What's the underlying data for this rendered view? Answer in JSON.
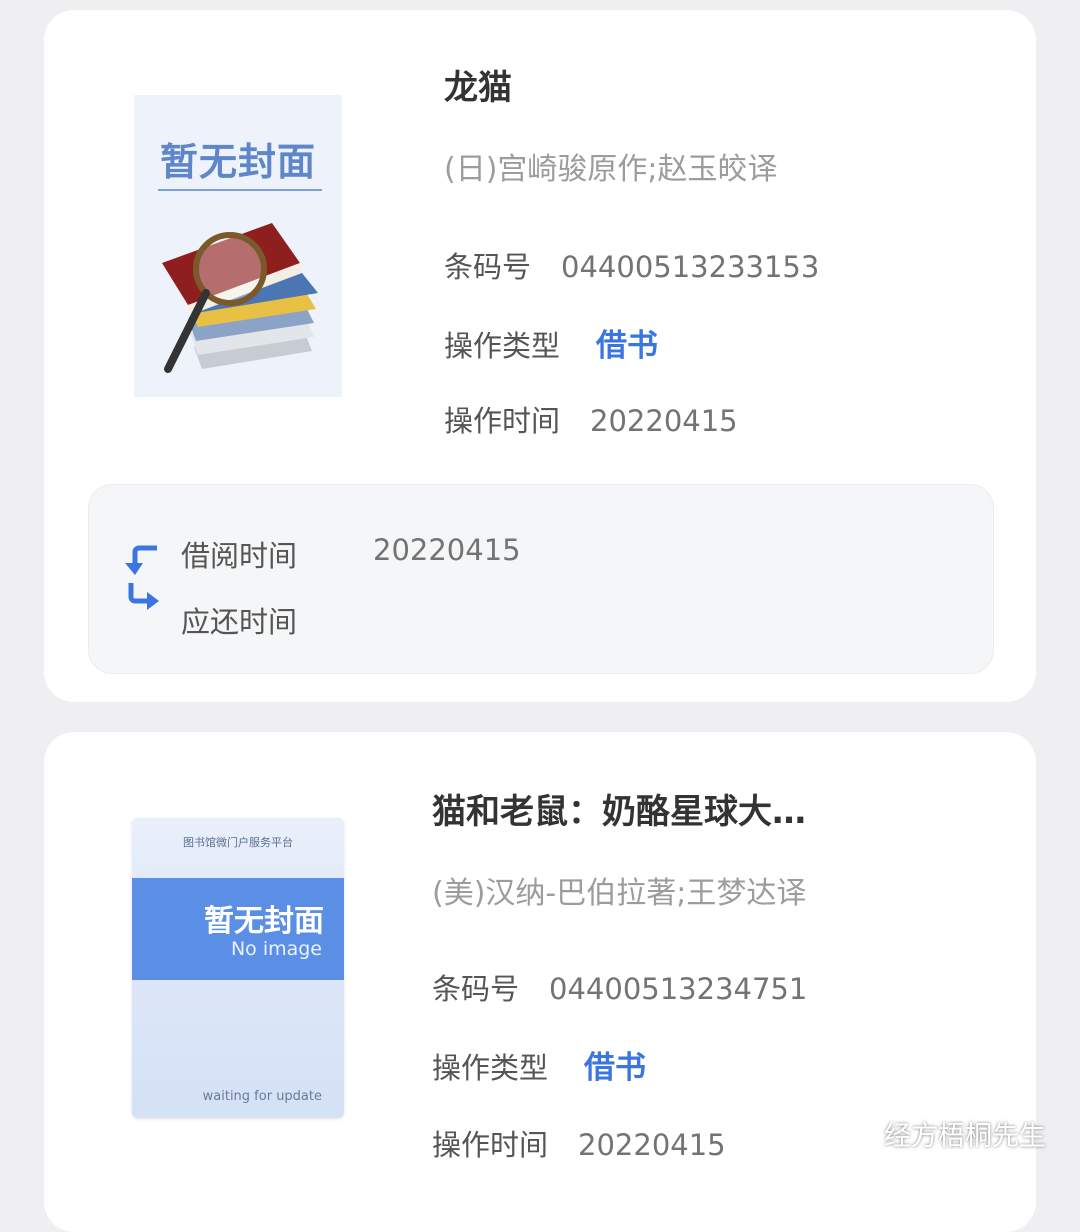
{
  "colors": {
    "accent": "#3b76e0",
    "page_bg": "#efeff1",
    "card_bg": "#ffffff"
  },
  "records": [
    {
      "title": "龙猫",
      "author": "(日)宫崎骏原作;赵玉皎译",
      "cover": {
        "placeholder_title": "暂无封面",
        "icon": "book-stack-magnifier-icon"
      },
      "barcode_label": "条码号",
      "barcode": "04400513233153",
      "op_type_label": "操作类型",
      "op_type": "借书",
      "op_time_label": "操作时间",
      "op_time": "20220415",
      "borrow": {
        "icon": "borrow-return-arrows-icon",
        "borrow_time_label": "借阅时间",
        "borrow_time": "20220415",
        "due_time_label": "应还时间"
      }
    },
    {
      "title": "猫和老鼠：奶酪星球大…",
      "author": "(美)汉纳-巴伯拉著;王梦达译",
      "cover": {
        "platform": "图书馆微门户服务平台",
        "placeholder_title": "暂无封面",
        "placeholder_sub": "No image",
        "footer": "waiting for update"
      },
      "barcode_label": "条码号",
      "barcode": "04400513234751",
      "op_type_label": "操作类型",
      "op_type": "借书",
      "op_time_label": "操作时间",
      "op_time": "20220415"
    }
  ],
  "watermark": {
    "text": "经方梧桐先生",
    "icon": "wechat-logo-icon"
  }
}
